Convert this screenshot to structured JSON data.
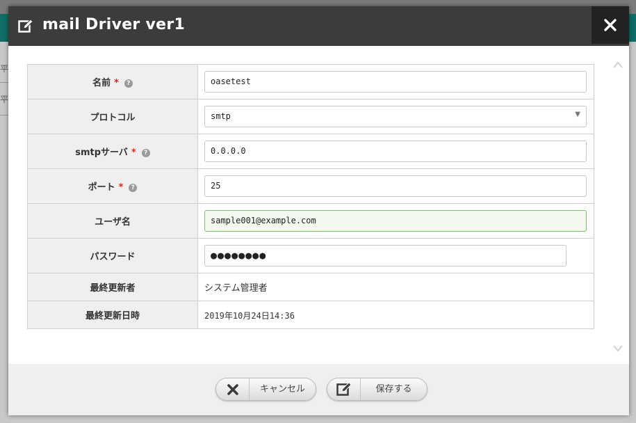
{
  "background": {
    "side_glyphs": [
      "平",
      "平"
    ]
  },
  "modal": {
    "title": "mail Driver ver1",
    "close_glyph": "✕",
    "fields": [
      {
        "label": "名前",
        "required": "*",
        "type": "text",
        "value": "oasetest"
      },
      {
        "label": "プロトコル",
        "type": "select",
        "value": "smtp",
        "arrow": "▼"
      },
      {
        "label": "smtpサーバ",
        "required": "*",
        "type": "text",
        "value": "0.0.0.0"
      },
      {
        "label": "ポート",
        "required": "*",
        "type": "text",
        "value": "25"
      },
      {
        "label": "ユーザ名",
        "type": "text",
        "value": "sample001@example.com"
      },
      {
        "label": "パスワード",
        "type": "password",
        "value": "●●●●●●●●"
      },
      {
        "label": "最終更新者",
        "type": "static",
        "value": "システム管理者"
      },
      {
        "label": "最終更新日時",
        "type": "static",
        "value": "2019年10月24日14:36"
      }
    ],
    "help_glyph": "?",
    "footer": {
      "cancel_label": "キャンセル",
      "save_label": "保存する"
    }
  },
  "colors": {
    "header_bg": "#3c3c3c",
    "close_bg": "#222222",
    "required": "#d9261c",
    "focus_bg": "#f1faec",
    "focus_border": "#7cc46b"
  },
  "icons": {
    "title": "edit-icon",
    "close": "close-icon",
    "help": "help-circle-icon",
    "cancel": "x-icon",
    "save": "edit-icon",
    "scroll_up": "chevron-up-icon",
    "scroll_down": "chevron-down-icon"
  }
}
